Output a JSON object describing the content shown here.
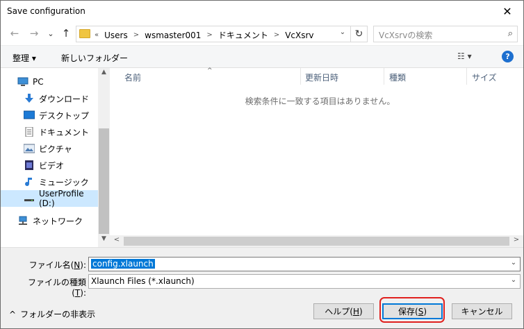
{
  "titlebar": {
    "title": "Save configuration",
    "close_glyph": "✕"
  },
  "nav": {
    "back_glyph": "←",
    "forward_glyph": "→",
    "recent_glyph": "⌄",
    "up_glyph": "↑",
    "address": {
      "prefix": "«",
      "crumbs": [
        "Users",
        "wsmaster001",
        "ドキュメント",
        "VcXsrv"
      ],
      "sep": ">",
      "dropdown_glyph": "⌄",
      "refresh_glyph": "↻"
    },
    "search_placeholder": "VcXsrvの検索",
    "search_icon_glyph": "⌕"
  },
  "toolbar": {
    "organize_label": "整理 ▾",
    "new_folder_label": "新しいフォルダー",
    "view_glyph": "☷ ▾",
    "help_glyph": "?"
  },
  "navpane": {
    "items": [
      {
        "label": "PC",
        "icon": "pc-icon"
      },
      {
        "label": "ダウンロード",
        "icon": "download-icon"
      },
      {
        "label": "デスクトップ",
        "icon": "desktop-icon"
      },
      {
        "label": "ドキュメント",
        "icon": "documents-icon"
      },
      {
        "label": "ピクチャ",
        "icon": "pictures-icon"
      },
      {
        "label": "ビデオ",
        "icon": "videos-icon"
      },
      {
        "label": "ミュージック",
        "icon": "music-icon"
      },
      {
        "label": "UserProfile (D:)",
        "icon": "drive-icon",
        "selected": true
      },
      {
        "label": "ネットワーク",
        "icon": "network-icon"
      }
    ],
    "scroll_up_glyph": "▲",
    "scroll_down_glyph": "▼"
  },
  "filelist": {
    "columns": [
      "名前",
      "更新日時",
      "種類",
      "サイズ"
    ],
    "sort_glyph": "^",
    "empty_message": "検索条件に一致する項目はありません。",
    "scroll_left_glyph": "<",
    "scroll_right_glyph": ">"
  },
  "form": {
    "filename_label_pre": "ファイル名(",
    "filename_label_key": "N",
    "filename_label_post": "):",
    "filename_value": "config.xlaunch",
    "filetype_label_pre": "ファイルの種類(",
    "filetype_label_key": "T",
    "filetype_label_post": "):",
    "filetype_value": "Xlaunch Files (*.xlaunch)",
    "dropdown_glyph": "⌄"
  },
  "footer": {
    "hide_folders_glyph": "^",
    "hide_folders_label": "フォルダーの非表示",
    "help_pre": "ヘルプ(",
    "help_key": "H",
    "help_post": ")",
    "save_pre": "保存(",
    "save_key": "S",
    "save_post": ")",
    "cancel_label": "キャンセル"
  },
  "colors": {
    "accent": "#0078d7",
    "selected_nav_bg": "#cce8ff",
    "highlight_ring": "#e0201e",
    "help_icon": "#1d6fcf"
  }
}
